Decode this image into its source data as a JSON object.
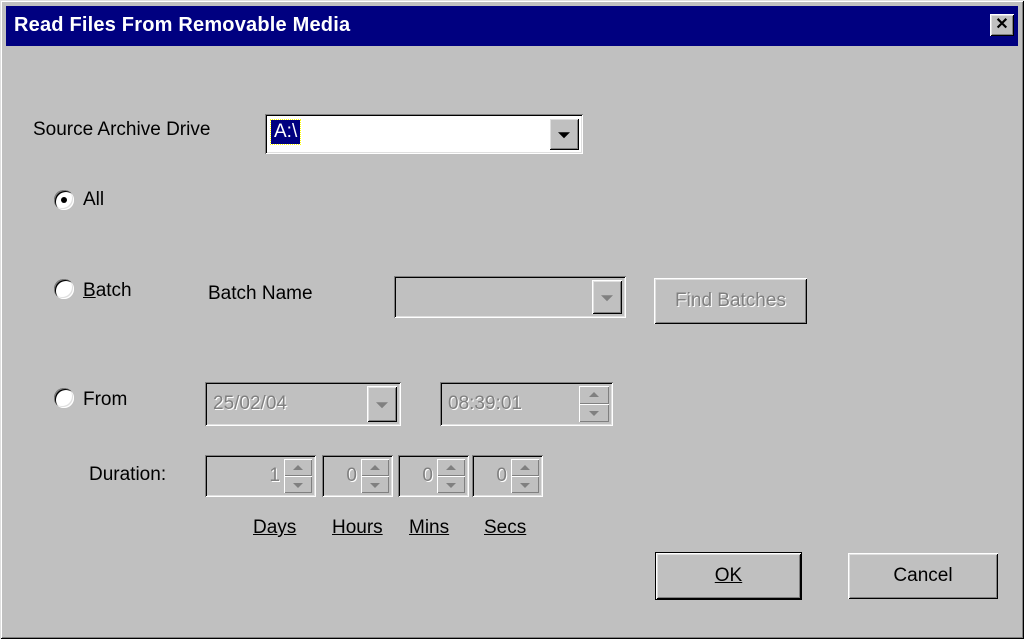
{
  "window": {
    "title": "Read Files From Removable Media",
    "close_glyph": "✕"
  },
  "source": {
    "label": "Source Archive Drive",
    "value": "A:\\"
  },
  "options": {
    "all_label": "All",
    "batch_label": "Batch",
    "batch_mnemonic": "B",
    "from_label": "From",
    "selected": "All"
  },
  "batch": {
    "name_label": "Batch Name",
    "name_value": "",
    "find_button": "Find Batches"
  },
  "from": {
    "date": "25/02/04",
    "time": "08:39:01"
  },
  "duration": {
    "label": "Duration:",
    "days": "1",
    "hours": "0",
    "mins": "0",
    "secs": "0",
    "days_label": "Days",
    "hours_label": "Hours",
    "mins_label": "Mins",
    "secs_label": "Secs"
  },
  "buttons": {
    "ok": "OK",
    "cancel": "Cancel"
  },
  "icons": {
    "close": "close-icon",
    "dropdown": "chevron-down-icon",
    "spin_up": "spin-up-icon",
    "spin_down": "spin-down-icon"
  }
}
